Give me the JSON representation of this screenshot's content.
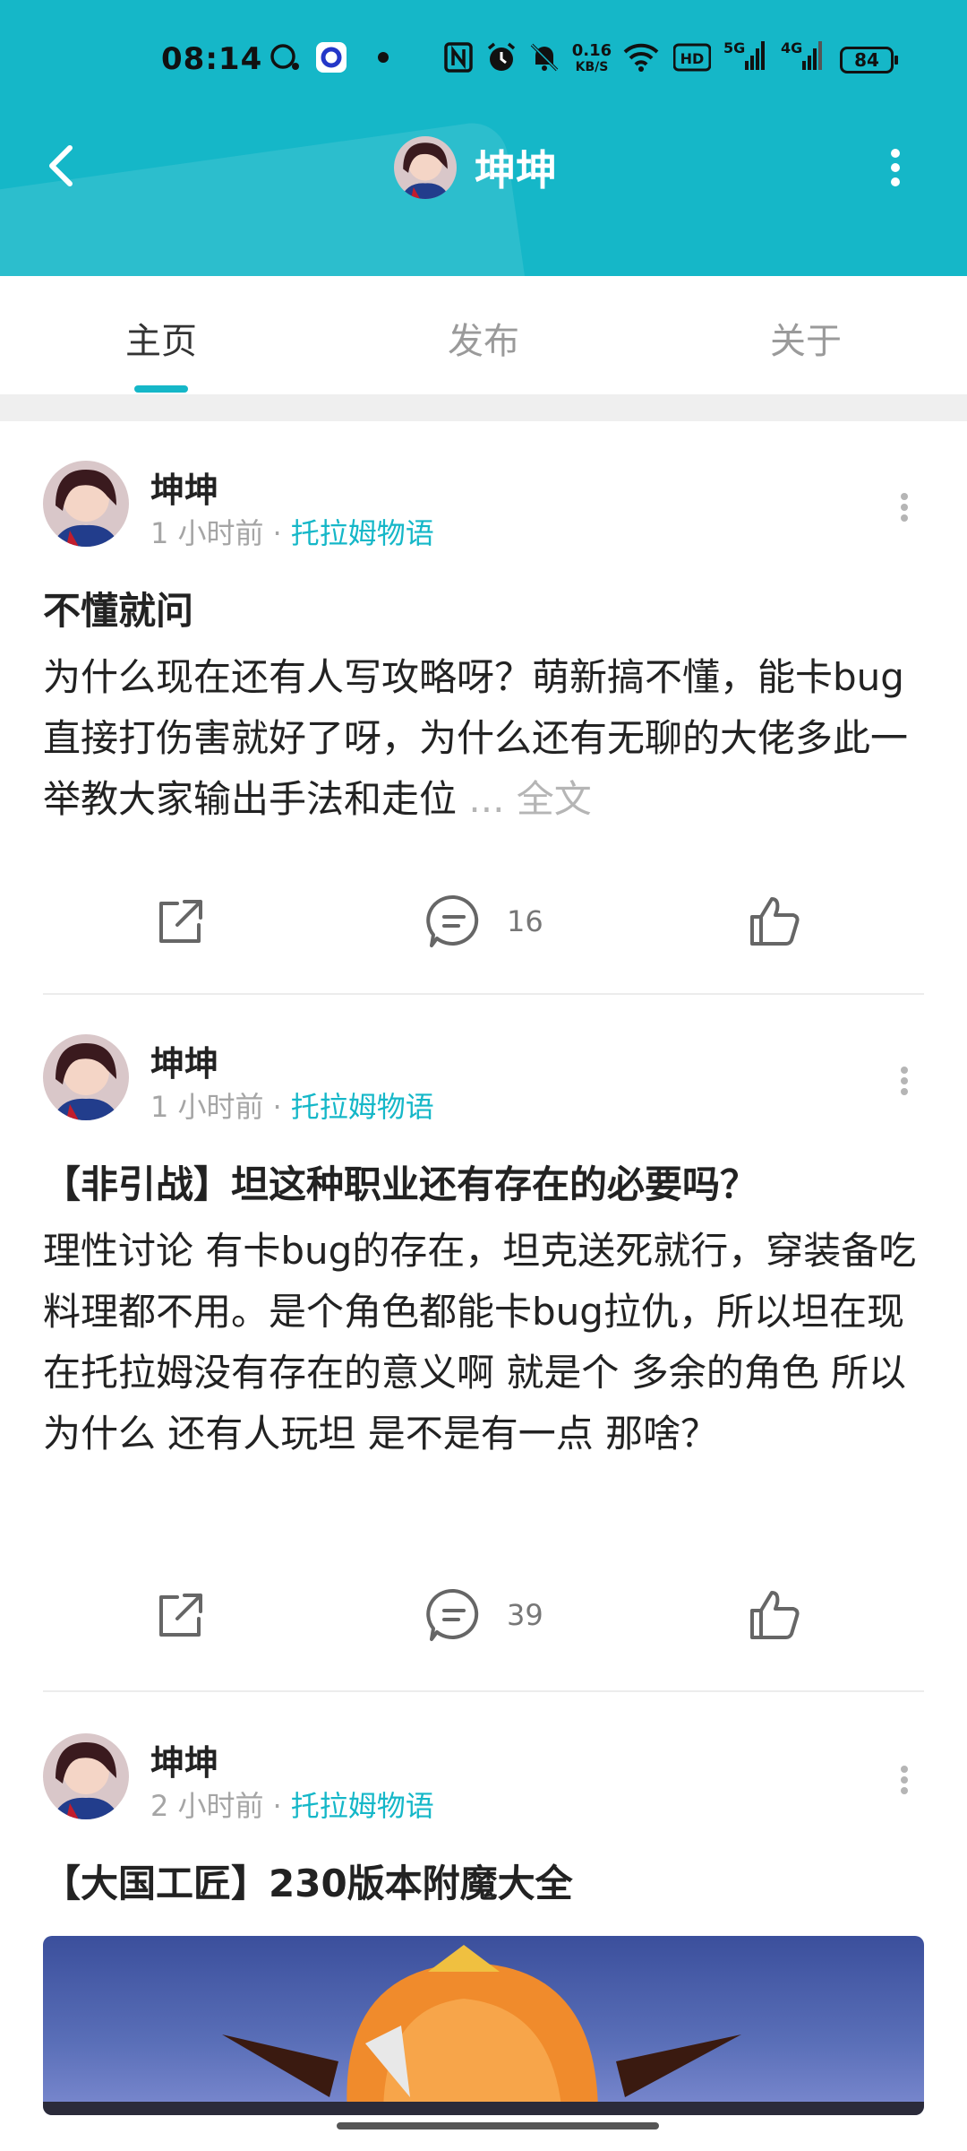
{
  "status_bar": {
    "time": "08:14",
    "network_speed": "0.16",
    "network_speed_unit": "KB/S",
    "signal_1": "5G",
    "signal_2": "4G",
    "battery": "84"
  },
  "header": {
    "title": "坤坤",
    "accent_color": "#15b7c8"
  },
  "tabs": [
    {
      "label": "主页",
      "active": true
    },
    {
      "label": "发布",
      "active": false
    },
    {
      "label": "关于",
      "active": false
    }
  ],
  "posts": [
    {
      "author": "坤坤",
      "time": "1 小时前",
      "separator": "·",
      "game": "托拉姆物语",
      "title": "不懂就问",
      "body": "为什么现在还有人写攻略呀？萌新搞不懂，能卡bug直接打伤害就好了呀，为什么还有无聊的大佬多此一举教大家输出手法和走位",
      "more_label": "... 全文",
      "comments": "16"
    },
    {
      "author": "坤坤",
      "time": "1 小时前",
      "separator": "·",
      "game": "托拉姆物语",
      "title": "【非引战】坦这种职业还有存在的必要吗？",
      "body": "理性讨论 有卡bug的存在，坦克送死就行，穿装备吃料理都不用。是个角色都能卡bug拉仇，所以坦在现在托拉姆没有存在的意义啊 就是个 多余的角色 所以为什么 还有人玩坦 是不是有一点 那啥？",
      "comments": "39"
    },
    {
      "author": "坤坤",
      "time": "2 小时前",
      "separator": "·",
      "game": "托拉姆物语",
      "title": "【大国工匠】230版本附魔大全"
    }
  ]
}
